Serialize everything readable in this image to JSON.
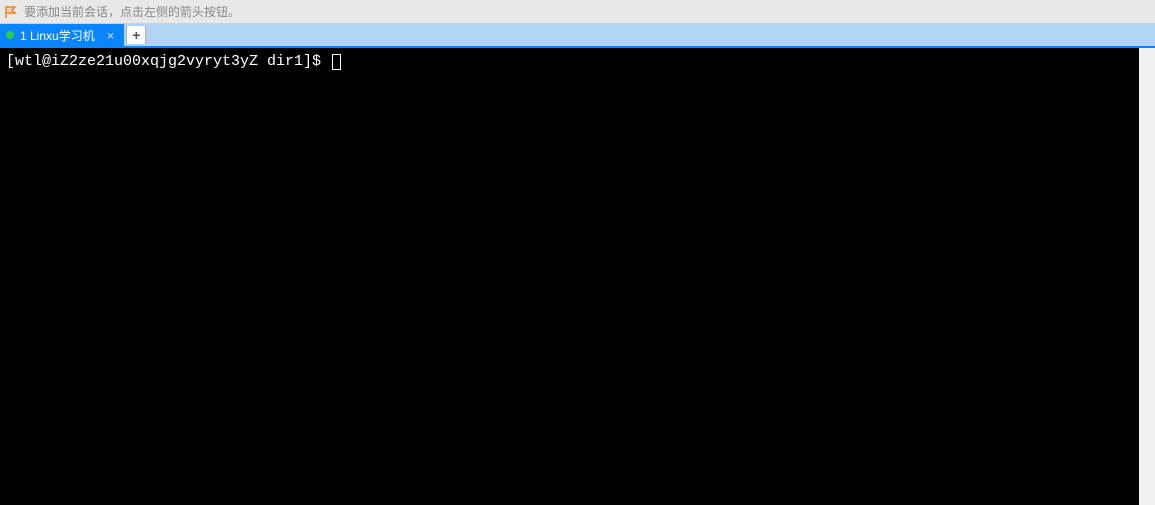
{
  "hint": {
    "text": "要添加当前会话，点击左侧的箭头按钮。"
  },
  "tabs": {
    "active": {
      "label": "1 Linxu学习机",
      "status": "connected"
    },
    "new_tab_symbol": "+"
  },
  "terminal": {
    "prompt": "[wtl@iZ2ze21u00xqjg2vyryt3yZ dir1]$ "
  }
}
